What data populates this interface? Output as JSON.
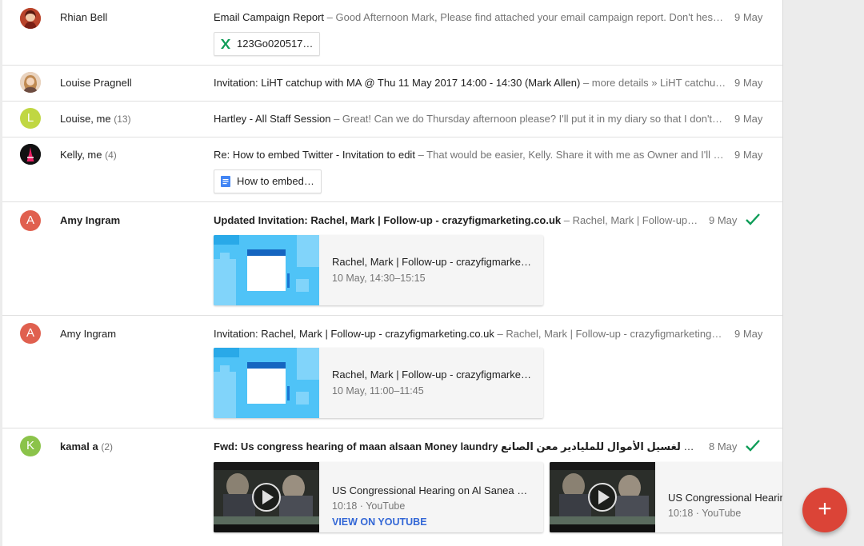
{
  "colors": {
    "accent_red": "#db4437",
    "check_green": "#0f9d58",
    "link_blue": "#3367d6"
  },
  "threads": [
    {
      "sender": "Rhian Bell",
      "count": "",
      "subject": "Email Campaign Report",
      "snippet": "– Good Afternoon Mark, Please find attached your email campaign report. Don't hes…",
      "date": "9 May",
      "attachment": {
        "icon": "sheets-icon",
        "label": "123Go020517…"
      }
    },
    {
      "sender": "Louise Pragnell",
      "count": "",
      "subject": "Invitation: LiHT catchup with MA @ Thu 11 May 2017 14:00 - 14:30 (Mark Allen)",
      "snippet": "– more details » LiHT catchu…",
      "date": "9 May"
    },
    {
      "sender": "Louise, me",
      "count": "(13)",
      "avatar_letter": "L",
      "subject": "Hartley - All Staff Session",
      "snippet": "– Great! Can we do Thursday afternoon please? I'll put it in my diary so that I don't…",
      "date": "9 May"
    },
    {
      "sender": "Kelly, me",
      "count": "(4)",
      "subject": "Re: How to embed Twitter - Invitation to edit",
      "snippet": "– That would be easier, Kelly. Share it with me as Owner and I'll …",
      "date": "9 May",
      "attachment": {
        "icon": "docs-icon",
        "label": "How to embed…"
      }
    },
    {
      "sender": "Amy Ingram",
      "count": "",
      "avatar_letter": "A",
      "subject": "Updated Invitation: Rachel, Mark | Follow-up - crazyfigmarketing.co.uk",
      "snippet": "– Rachel, Mark | Follow-up…",
      "date": "9 May",
      "event": {
        "title": "Rachel, Mark | Follow-up - crazyfigmarke…",
        "time": "10 May, 14:30–15:15"
      }
    },
    {
      "sender": "Amy Ingram",
      "count": "",
      "avatar_letter": "A",
      "subject": "Invitation: Rachel, Mark | Follow-up - crazyfigmarketing.co.uk",
      "snippet": "– Rachel, Mark | Follow-up - crazyfigmarketing…",
      "date": "9 May",
      "event": {
        "title": "Rachel, Mark | Follow-up - crazyfigmarke…",
        "time": "10 May, 11:00–11:45"
      }
    },
    {
      "sender": "kamal a",
      "count": "(2)",
      "avatar_letter": "K",
      "subject": "Fwd: Us congress hearing of maan alsaan Money laundry قضية الكونغجرس لغسيل الأموال للمليادير معن الصانع",
      "snippet": "–…",
      "date": "8 May",
      "videos": [
        {
          "title": "US Congressional Hearing on Al Sanea a…",
          "duration": "10:18",
          "source": "YouTube",
          "action": "VIEW ON YOUTUBE"
        },
        {
          "title": "US Congressional Hearing on Al Sanea a…",
          "duration": "10:18",
          "source": "YouTube",
          "action": ""
        }
      ]
    }
  ],
  "separator": "·",
  "fab": {
    "icon": "plus-icon",
    "label": "+"
  }
}
